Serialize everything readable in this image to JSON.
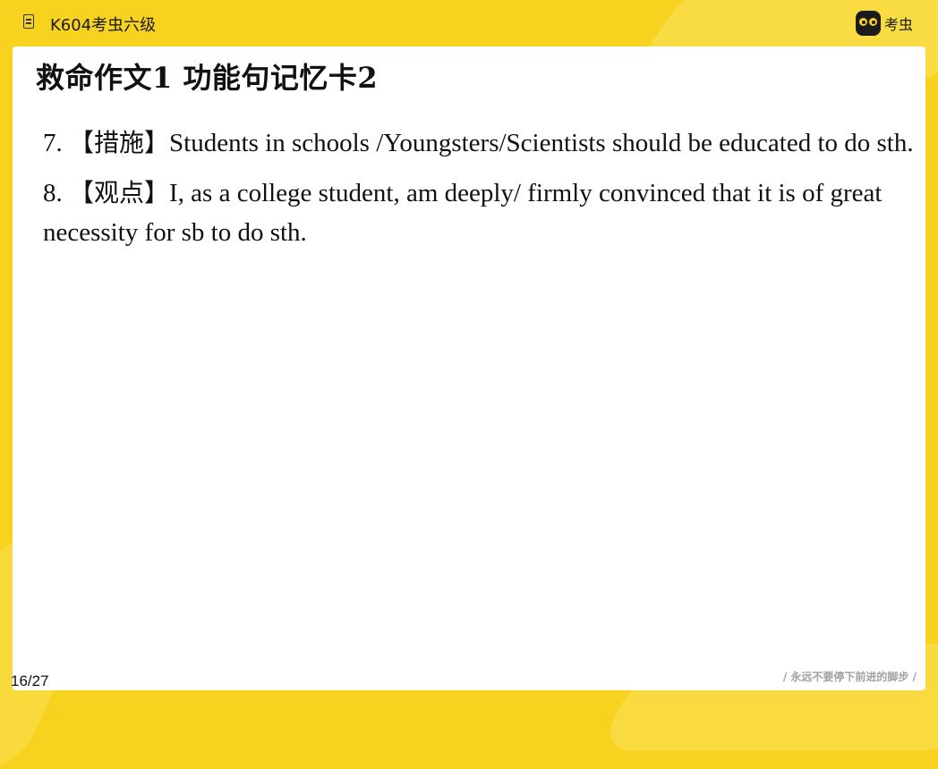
{
  "header": {
    "course_title": "K604考虫六级",
    "brand_name": "考虫"
  },
  "slide": {
    "title": "救命作文1 功能句记忆卡2",
    "points": [
      {
        "number": "7.",
        "tag": "【措施】",
        "text": "Students in schools /Youngsters/Scientists should be educated to do sth."
      },
      {
        "number": "8.",
        "tag": "【观点】",
        "text": "I, as a college student, am deeply/ firmly convinced that it is of great necessity for sb to do sth."
      }
    ]
  },
  "footer": {
    "page_indicator": "16/27",
    "slogan": "/ 永远不要停下前进的脚步 /"
  },
  "colors": {
    "frame": "#f7d21e",
    "slide_bg": "#ffffff",
    "text": "#111111"
  },
  "icons": {
    "document": "document-icon",
    "brand_logo": "kaochong-logo-icon"
  }
}
